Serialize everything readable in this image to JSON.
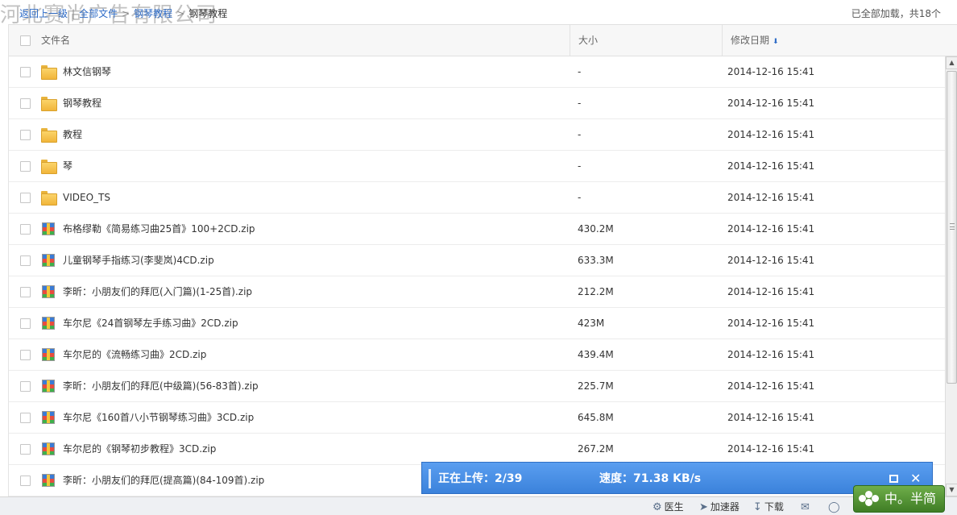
{
  "watermark": "河北赛尚广告有限公司",
  "breadcrumb": {
    "back": "返回上一级",
    "all_files": "全部文件",
    "parent": "钢琴教程",
    "current": "钢琴教程"
  },
  "loaded_status": "已全部加载，共18个",
  "columns": {
    "name": "文件名",
    "size": "大小",
    "date": "修改日期"
  },
  "files": [
    {
      "type": "folder",
      "name": "林文信钢琴",
      "size": "-",
      "date": "2014-12-16 15:41"
    },
    {
      "type": "folder",
      "name": "钢琴教程",
      "size": "-",
      "date": "2014-12-16 15:41"
    },
    {
      "type": "folder",
      "name": "教程",
      "size": "-",
      "date": "2014-12-16 15:41"
    },
    {
      "type": "folder",
      "name": "琴",
      "size": "-",
      "date": "2014-12-16 15:41"
    },
    {
      "type": "folder",
      "name": "VIDEO_TS",
      "size": "-",
      "date": "2014-12-16 15:41"
    },
    {
      "type": "zip",
      "name": "布格缪勒《简易练习曲25首》100+2CD.zip",
      "size": "430.2M",
      "date": "2014-12-16 15:41"
    },
    {
      "type": "zip",
      "name": "儿童钢琴手指练习(李斐岚)4CD.zip",
      "size": "633.3M",
      "date": "2014-12-16 15:41"
    },
    {
      "type": "zip",
      "name": "李昕：小朋友们的拜厄(入门篇)(1-25首).zip",
      "size": "212.2M",
      "date": "2014-12-16 15:41"
    },
    {
      "type": "zip",
      "name": "车尔尼《24首钢琴左手练习曲》2CD.zip",
      "size": "423M",
      "date": "2014-12-16 15:41"
    },
    {
      "type": "zip",
      "name": "车尔尼的《流畅练习曲》2CD.zip",
      "size": "439.4M",
      "date": "2014-12-16 15:41"
    },
    {
      "type": "zip",
      "name": "李昕：小朋友们的拜厄(中级篇)(56-83首).zip",
      "size": "225.7M",
      "date": "2014-12-16 15:41"
    },
    {
      "type": "zip",
      "name": "车尔尼《160首八小节钢琴练习曲》3CD.zip",
      "size": "645.8M",
      "date": "2014-12-16 15:41"
    },
    {
      "type": "zip",
      "name": "车尔尼的《钢琴初步教程》3CD.zip",
      "size": "267.2M",
      "date": "2014-12-16 15:41"
    },
    {
      "type": "zip",
      "name": "李昕：小朋友们的拜厄(提高篇)(84-109首).zip",
      "size": "",
      "date": ""
    }
  ],
  "upload": {
    "progress": "正在上传：2/39",
    "speed": "速度：71.38 KB/s"
  },
  "bottom_bar": {
    "doctor": "医生",
    "accelerator": "加速器",
    "download": "下载"
  },
  "ime": {
    "label": "中。半简"
  },
  "colors": {
    "link": "#2d6bc7",
    "upload_bar": "#3b82db",
    "ime_badge": "#4f8f30"
  }
}
